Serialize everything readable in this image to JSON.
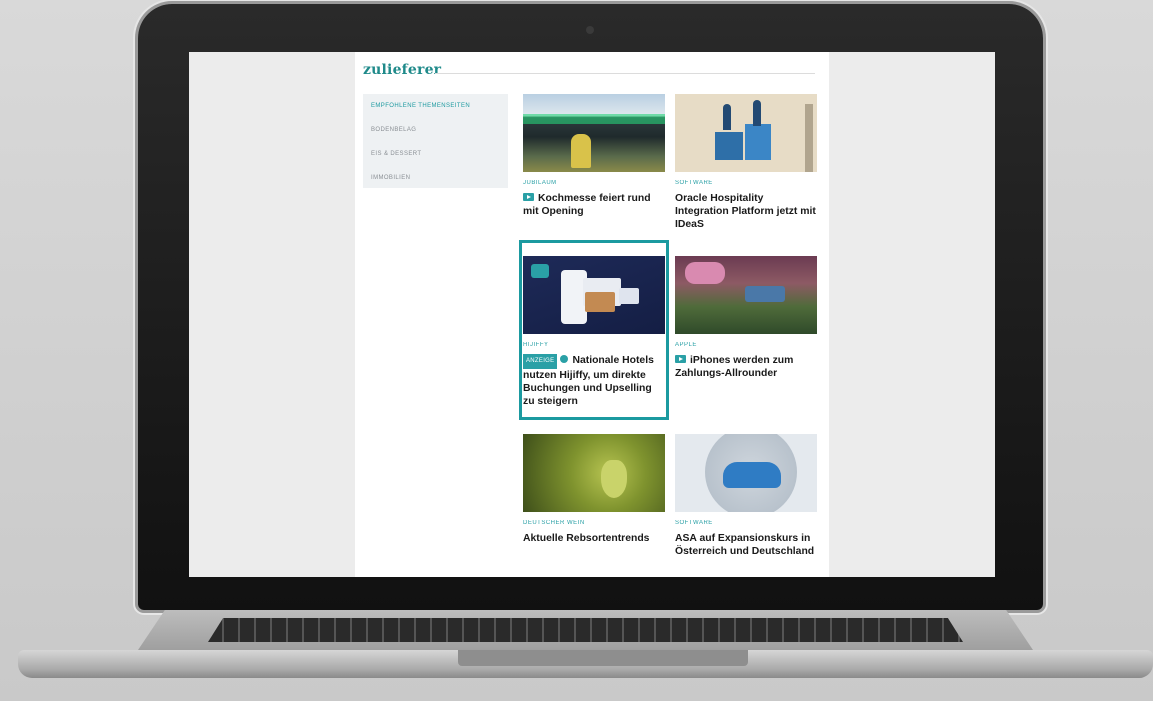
{
  "site": {
    "logo": "zulieferer"
  },
  "sidebar": {
    "items": [
      {
        "label": "EMPFOHLENE THEMENSEITEN",
        "active": true
      },
      {
        "label": "BODENBELAG",
        "active": false
      },
      {
        "label": "EIS & DESSERT",
        "active": false
      },
      {
        "label": "IMMOBILIEN",
        "active": false
      }
    ]
  },
  "cards": [
    {
      "category": "JUBILÄUM",
      "title": "Kochmesse feiert rund mit Opening",
      "badge": "video"
    },
    {
      "category": "SOFTWARE",
      "title": "Oracle Hospitality Integration Platform jetzt mit IDeaS",
      "badge": "none"
    },
    {
      "category": "HIJIFFY",
      "title": "Nationale Hotels nutzen Hijiffy, um direkte Buchungen und Upselling zu steigern",
      "badge": "anzeige",
      "ad_label": "ANZEIGE"
    },
    {
      "category": "APPLE",
      "title": "iPhones werden zum Zahlungs-Allrounder",
      "badge": "video"
    },
    {
      "category": "DEUTSCHER WEIN",
      "title": "Aktuelle Rebsortentrends",
      "badge": "none"
    },
    {
      "category": "SOFTWARE",
      "title": "ASA auf Expansionskurs in Österreich und Deutschland",
      "badge": "none"
    }
  ],
  "colors": {
    "accent": "#2aa0a6",
    "highlight": "#1b9aa0"
  }
}
